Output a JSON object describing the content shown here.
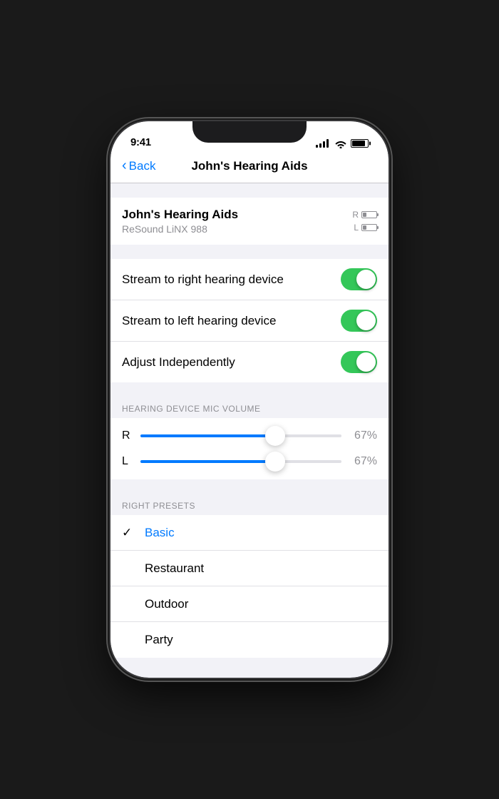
{
  "status_bar": {
    "time": "9:41"
  },
  "nav": {
    "back_label": "Back",
    "title": "John's Hearing Aids"
  },
  "device_card": {
    "name": "John's Hearing Aids",
    "model": "ReSound LiNX 988",
    "right_label": "R",
    "left_label": "L"
  },
  "toggles": [
    {
      "label": "Stream to right hearing device",
      "state": "on"
    },
    {
      "label": "Stream to left hearing device",
      "state": "on"
    },
    {
      "label": "Adjust Independently",
      "state": "on"
    }
  ],
  "sliders": {
    "section_title": "HEARING DEVICE MIC VOLUME",
    "items": [
      {
        "label": "R",
        "value": 67,
        "display": "67%"
      },
      {
        "label": "L",
        "value": 67,
        "display": "67%"
      }
    ]
  },
  "presets": {
    "section_title": "RIGHT PRESETS",
    "items": [
      {
        "name": "Basic",
        "active": true,
        "checked": true
      },
      {
        "name": "Restaurant",
        "active": false,
        "checked": false
      },
      {
        "name": "Outdoor",
        "active": false,
        "checked": false
      },
      {
        "name": "Party",
        "active": false,
        "checked": false
      }
    ]
  }
}
